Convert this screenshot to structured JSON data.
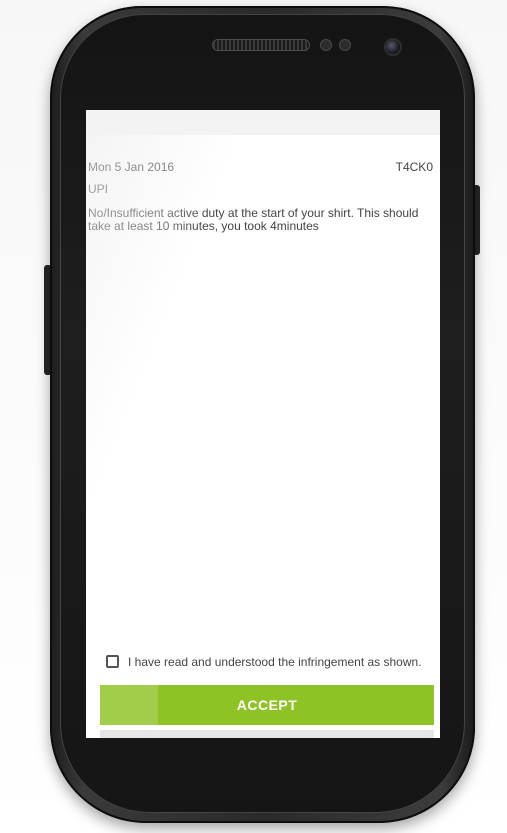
{
  "infringement": {
    "date": "Mon 5 Jan 2016",
    "code": "T4CK0",
    "category": "UPI",
    "description": "No/Insufficient active duty at the start of your shirt. This should take at least 10 minutes, you took 4minutes"
  },
  "acknowledgement": {
    "label": "I have read and understood the infringement as shown.",
    "checked": false
  },
  "actions": {
    "accept_label": "ACCEPT"
  },
  "colors": {
    "accent": "#8dc324",
    "text": "#444444",
    "device_body": "#2a2a2a"
  }
}
